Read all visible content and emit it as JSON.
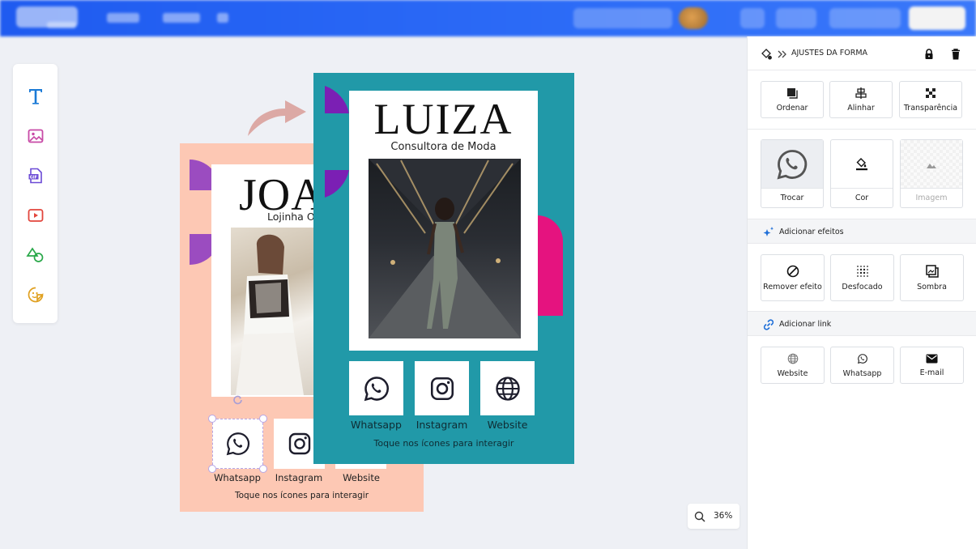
{
  "topbar": {
    "blurred": true
  },
  "tools": [
    {
      "name": "text-tool",
      "icon": "text-icon",
      "color": "#1a7ad6"
    },
    {
      "name": "image-tool",
      "icon": "image-icon",
      "color": "#c84aa6"
    },
    {
      "name": "gif-tool",
      "icon": "gif-icon",
      "color": "#6b4ad6"
    },
    {
      "name": "video-tool",
      "icon": "video-icon",
      "color": "#e2453c"
    },
    {
      "name": "shapes-tool",
      "icon": "shapes-icon",
      "color": "#2aa84a"
    },
    {
      "name": "sticker-tool",
      "icon": "sticker-icon",
      "color": "#e0a020"
    }
  ],
  "back_card": {
    "name": "JOA",
    "subtitle": "Lojinha O",
    "buttons": [
      "Whatsapp",
      "Instagram",
      "Website"
    ],
    "footer": "Toque nos ícones para interagir",
    "bg": "#fdc8b4"
  },
  "front_card": {
    "name": "LUIZA",
    "subtitle": "Consultora de Moda",
    "buttons": [
      "Whatsapp",
      "Instagram",
      "Website"
    ],
    "footer": "Toque nos ícones para interagir",
    "bg": "#2199a8"
  },
  "panel": {
    "title": "AJUSTES DA FORMA",
    "arrange": [
      "Ordenar",
      "Alinhar",
      "Transparência"
    ],
    "shape_tiles": [
      "Trocar",
      "Cor",
      "Imagem"
    ],
    "effects_title": "Adicionar efeitos",
    "effects": [
      "Remover efeito",
      "Desfocado",
      "Sombra"
    ],
    "link_title": "Adicionar link",
    "links": [
      "Website",
      "Whatsapp",
      "E-mail"
    ]
  },
  "zoom": {
    "value": "36%"
  }
}
